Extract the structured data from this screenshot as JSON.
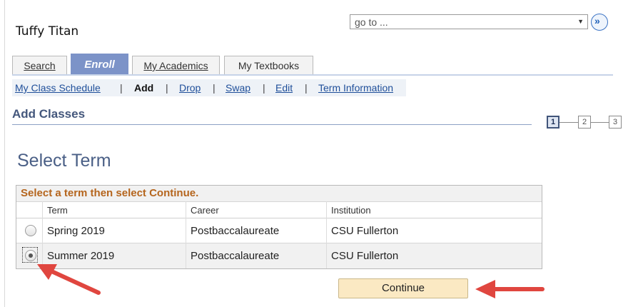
{
  "header": {
    "user_name": "Tuffy Titan",
    "goto_value": "go to ...",
    "goto_caret": "▼",
    "goto_button": "»"
  },
  "tabs": [
    {
      "label": "Search",
      "active": false
    },
    {
      "label": "Enroll",
      "active": true
    },
    {
      "label": "My Academics",
      "active": false
    },
    {
      "label": "My Textbooks",
      "active": false
    }
  ],
  "subnav": {
    "items": [
      "My Class Schedule",
      "Add",
      "Drop",
      "Swap",
      "Edit",
      "Term Information"
    ],
    "current": "Add",
    "separator": "|"
  },
  "page_title": "Add Classes",
  "steps": {
    "labels": [
      "1",
      "2",
      "3"
    ],
    "current": 1
  },
  "section_title": "Select Term",
  "grid": {
    "instruction": "Select a term then select Continue.",
    "columns": [
      "Term",
      "Career",
      "Institution"
    ],
    "rows": [
      {
        "term": "Spring 2019",
        "career": "Postbaccalaureate",
        "institution": "CSU Fullerton",
        "selected": false
      },
      {
        "term": "Summer 2019",
        "career": "Postbaccalaureate",
        "institution": "CSU Fullerton",
        "selected": true
      }
    ]
  },
  "continue_label": "Continue",
  "colors": {
    "active_tab": "#7c93c8",
    "title": "#44577c",
    "instruction": "#b5651d",
    "button": "#fbe9c3",
    "arrow": "#e0463f"
  }
}
